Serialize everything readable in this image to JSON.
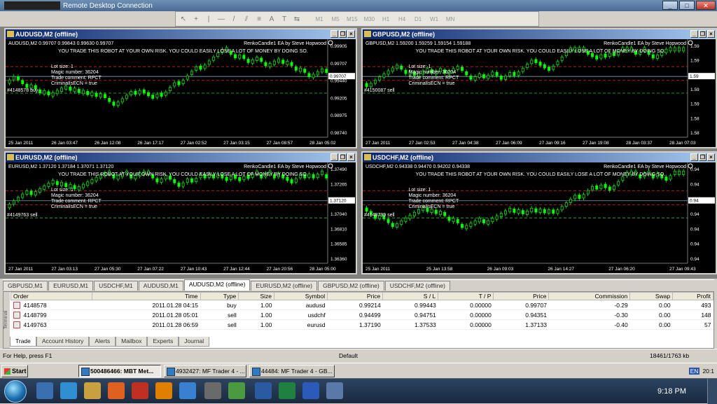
{
  "app_title": "Remote Desktop Connection",
  "toolbar": {
    "timeframes": [
      "M1",
      "M5",
      "M15",
      "M30",
      "H1",
      "H4",
      "D1",
      "W1",
      "MN"
    ]
  },
  "windows": [
    {
      "key": "audusd",
      "title": "AUDUSD,M2 (offline)",
      "header": "AUDUSD,M2  0.99707 0.99843 0.99630 0.99707",
      "ea": "RenkoCandle1 EA by Steve Hopwood",
      "warning": "YOU TRADE THIS ROBOT AT YOUR OWN RISK. YOU COULD EASILY LOSE A LOT OF MONEY BY DOING SO.",
      "info": [
        "Lot size: 1",
        "Magic number: 36204",
        "Trade comment: RPCT",
        "CriminalIsECN = true"
      ],
      "order_label": "#4148578 buy",
      "prices": [
        "0.99905",
        "0.99707",
        "0.99440",
        "0.99205",
        "0.98975",
        "0.98740"
      ],
      "price_marker": "0.99707",
      "dates": [
        "25 Jan 2011",
        "26 Jan 03:47",
        "26 Jan 12:08",
        "26 Jan 17:17",
        "27 Jan 02:52",
        "27 Jan 03:15",
        "27 Jan 08:57",
        "28 Jan 05:02"
      ],
      "accent": "#00ff00"
    },
    {
      "key": "gbpusd",
      "title": "GBPUSD,M2 (offline)",
      "header": "GBPUSD,M2  1.59200 1.59259 1.59154 1.59188",
      "ea": "RenkoCandle1 EA by Steve Hopwood",
      "warning": "YOU TRADE THIS ROBOT AT YOUR OWN RISK. YOU COULD EASILY LOSE A LOT OF MONEY BY DOING SO.",
      "info": [
        "Lot size: 1",
        "Magic number: 36204",
        "Trade comment: RPCT",
        "CriminalIsECN = true"
      ],
      "order_label": "#4150087 sell",
      "prices": [
        "1.59",
        "1.59",
        "1.59",
        "1.59",
        "1.59",
        "1.58",
        "1.58"
      ],
      "price_marker": "1.59",
      "dates": [
        "27 Jan 2011",
        "27 Jan 02:53",
        "27 Jan 04:38",
        "27 Jan 06:09",
        "27 Jan 09:16",
        "27 Jan 19:08",
        "28 Jan 03:37",
        "28 Jan 07:03"
      ],
      "accent": "#00ff00"
    },
    {
      "key": "eurusd",
      "title": "EURUSD,M2 (offline)",
      "header": "EURUSD,M2  1.37120 1.37184 1.37071 1.37120",
      "ea": "RenkoCandle1 EA by Steve Hopwood",
      "warning": "YOU TRADE THIS ROBOT AT YOUR OWN RISK. YOU COULD EASILY LOSE A LOT OF MONEY BY DOING SO.",
      "info": [
        "Lot size: 1",
        "Magic number: 36204",
        "Trade comment: RPCT",
        "CriminalIsECN = true"
      ],
      "order_label": "#4149763 sell",
      "prices": [
        "1.37490",
        "1.37265",
        "1.37120",
        "1.37040",
        "1.36810",
        "1.36585",
        "1.36360"
      ],
      "price_marker": "1.37120",
      "dates": [
        "27 Jan 2011",
        "27 Jan 03:13",
        "27 Jan 05:30",
        "27 Jan 07:22",
        "27 Jan 10:43",
        "27 Jan 12:44",
        "27 Jan 20:56",
        "28 Jan 05:00"
      ],
      "accent": "#00ff00"
    },
    {
      "key": "usdchf",
      "title": "USDCHF,M2 (offline)",
      "header": "USDCHF,M2  0.94338 0.94470 0.94202 0.94338",
      "ea": "RenkoCandle1 EA by Steve Hopwood",
      "warning": "YOU TRADE THIS ROBOT AT YOUR OWN RISK. YOU COULD EASILY LOSE A LOT OF MONEY BY DOING SO.",
      "info": [
        "Lot size: 1",
        "Magic number: 36204",
        "Trade comment: RPCT",
        "CriminalIsECN = true"
      ],
      "order_label": "#4148799 sell",
      "prices": [
        "0.94",
        "0.94",
        "0.94",
        "0.94",
        "0.94",
        "0.94",
        "0.94"
      ],
      "price_marker": "0.94",
      "dates": [
        "25 Jan 2011",
        "25 Jan 13:58",
        "26 Jan 09:03",
        "26 Jan 14:27",
        "27 Jan 06:20",
        "27 Jan 09:43"
      ],
      "accent": "#00ff00"
    }
  ],
  "chart_tabs": [
    "GBPUSD,M1",
    "EURUSD,M1",
    "USDCHF,M1",
    "AUDUSD,M1",
    "AUDUSD,M2 (offline)",
    "EURUSD,M2 (offline)",
    "GBPUSD,M2 (offline)",
    "USDCHF,M2 (offline)"
  ],
  "active_chart_tab": "AUDUSD,M2 (offline)",
  "terminal": {
    "side_label": "Terminal",
    "columns": [
      "Order",
      "Time",
      "Type",
      "Size",
      "Symbol",
      "Price",
      "S / L",
      "T / P",
      "Price",
      "Commission",
      "Swap",
      "Profit"
    ],
    "rows": [
      [
        "4148578",
        "2011.01.28 04:15",
        "buy",
        "1.00",
        "audusd",
        "0.99214",
        "0.99443",
        "0.00000",
        "0.99707",
        "-0.29",
        "0.00",
        "493"
      ],
      [
        "4148799",
        "2011.01.28 05:01",
        "sell",
        "1.00",
        "usdchf",
        "0.94499",
        "0.94751",
        "0.00000",
        "0.94351",
        "-0.30",
        "0.00",
        "148"
      ],
      [
        "4149763",
        "2011.01.28 06:59",
        "sell",
        "1.00",
        "eurusd",
        "1.37190",
        "1.37533",
        "0.00000",
        "1.37133",
        "-0.40",
        "0.00",
        "57"
      ]
    ],
    "tabs": [
      "Trade",
      "Account History",
      "Alerts",
      "Mailbox",
      "Experts",
      "Journal"
    ],
    "active_tab": "Trade"
  },
  "status": {
    "help": "For Help, press F1",
    "profile": "Default",
    "traffic": "18461/1763 kb"
  },
  "taskbar_xp": {
    "start": "Start",
    "items": [
      "500486466: MBT Met...",
      "4932427: MF Trader 4 - ...",
      "44484: MF Trader 4 - GB..."
    ],
    "lang": "EN",
    "time": "20:1"
  },
  "taskbar_win7": {
    "time": "9:18 PM"
  }
}
